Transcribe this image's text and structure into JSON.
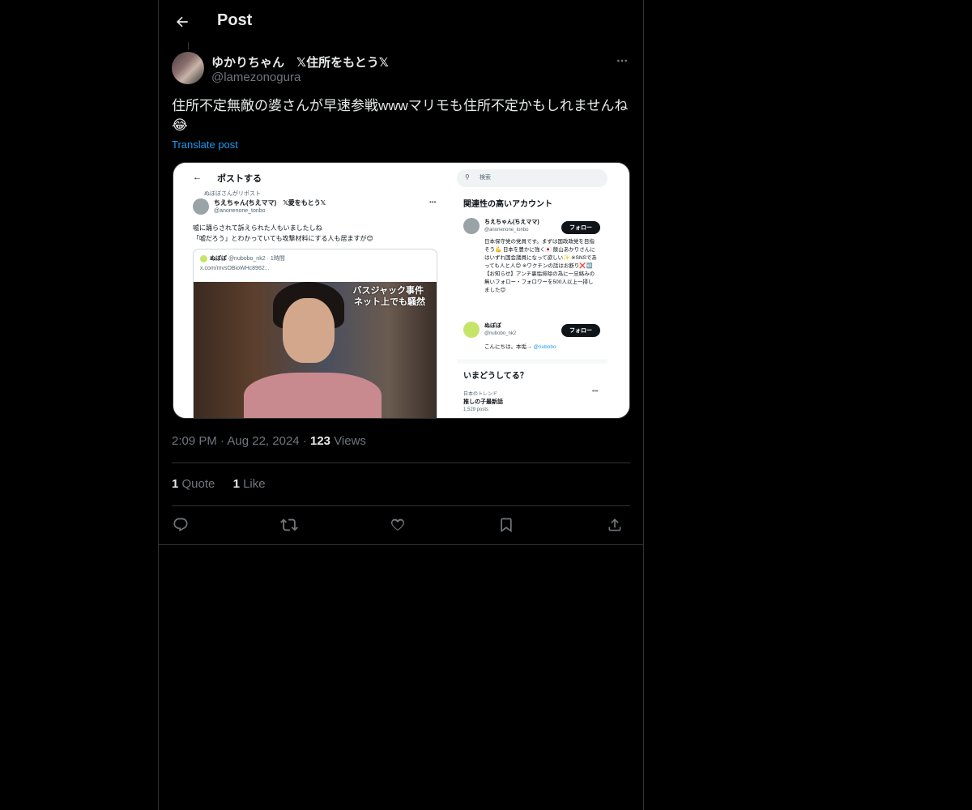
{
  "header": {
    "title": "Post"
  },
  "post": {
    "display_name": "ゆかりちゃん　𝕏住所をもとう𝕏",
    "handle": "@lamezonogura",
    "text": "住所不定無敵の婆さんが早速参戦wwwマリモも住所不定かもしれませんね😂",
    "translate_label": "Translate post",
    "time": "2:09 PM",
    "date": "Aug 22, 2024",
    "views_count": "123",
    "views_label": "Views",
    "quotes_count": "1",
    "quotes_label": "Quote",
    "likes_count": "1",
    "likes_label": "Like"
  },
  "embedded": {
    "title": "ポストする",
    "repost_note": "ぬぼぼさんがリポスト",
    "author_name": "ちえちゃん(ちえママ)　𝕏愛をもとう𝕏",
    "author_handle": "@anonenone_tonbo",
    "text_line1": "嘘に踊らされて訴えられた人もいましたしね",
    "text_line2": "「嘘だろう」とわかっていても攻撃材料にする人も居ますが😊",
    "card_author": "ぬぼぼ",
    "card_meta": "@nubobo_nk2 · 1時間",
    "card_link": "x.com/mvsOBioWHc8962...",
    "caption1": "バスジャック事件",
    "caption2": "ネット上でも騒然",
    "search_placeholder": "検索",
    "related_title": "関連性の高いアカウント",
    "acct1_name": "ちえちゃん(ちえママ)",
    "acct1_handle": "@anonenone_tonbo",
    "follow_label": "フォロー",
    "acct1_bio": "日本保守党の党員です。まずは国政政党を目指そう💪 日本を豊かに強く🇯🇵 飯山あかりさんにはいずれ国会議員になって欲しい✨ ※SNSであっても人と人😊 ※ワクチンの話はお断り❌🆖【お知らせ】アンチ裏垢排除の為に一旦絡みの無いフォロー・フォロワーを500人以上一掃しました😊",
    "acct2_name": "ぬぼぼ",
    "acct2_handle": "@nubobo_nk2",
    "acct2_bio": "こんにちは。本垢→",
    "acct2_bio_link": "@nubobo",
    "trend_title": "いまどうしてる？",
    "trend_category": "日本のトレンド",
    "trend_name": "推しの子最新話",
    "trend_count": "1,529 posts"
  },
  "colors": {
    "background": "#000000",
    "text": "#e7e9ea",
    "muted": "#71767b",
    "accent": "#1d9bf0",
    "border": "#2f3336"
  },
  "icons": [
    "back-arrow-icon",
    "more-icon",
    "reply-icon",
    "repost-icon",
    "like-icon",
    "bookmark-icon",
    "share-icon"
  ]
}
